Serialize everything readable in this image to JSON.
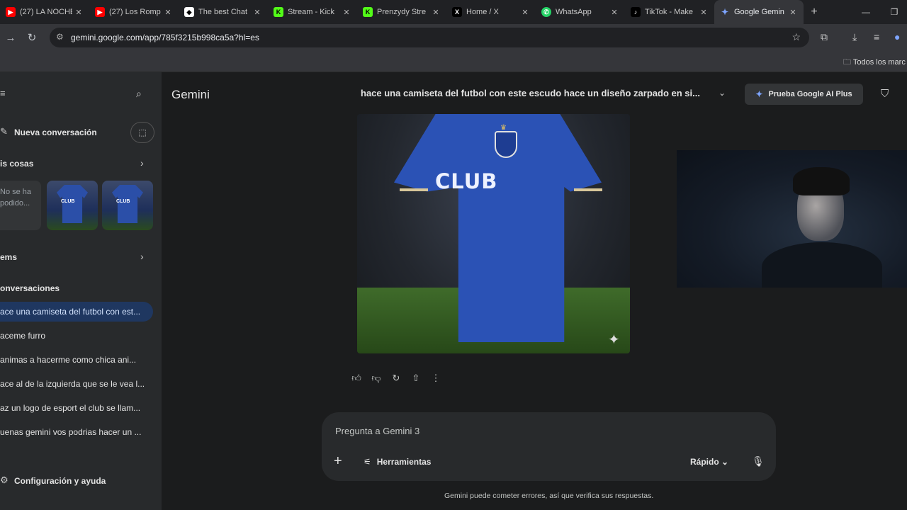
{
  "browser": {
    "tabs": [
      {
        "label": "(27) LA NOCHE",
        "favicon": "youtube-icon",
        "color": "#ff0000"
      },
      {
        "label": "(27) Los Romp",
        "favicon": "youtube-icon",
        "color": "#ff0000"
      },
      {
        "label": "The best Chat",
        "favicon": "chat-icon",
        "color": "#ffffff"
      },
      {
        "label": "Stream - Kick",
        "favicon": "kick-icon",
        "color": "#53fc18"
      },
      {
        "label": "Prenzydy Stre",
        "favicon": "kick-icon",
        "color": "#53fc18"
      },
      {
        "label": "Home / X",
        "favicon": "x-icon",
        "color": "#ffffff"
      },
      {
        "label": "WhatsApp",
        "favicon": "whatsapp-icon",
        "color": "#25d366"
      },
      {
        "label": "TikTok - Make",
        "favicon": "tiktok-icon",
        "color": "#ffffff"
      },
      {
        "label": "Google Gemin",
        "favicon": "gemini-icon",
        "color": "#7ea5ff",
        "active": true
      }
    ],
    "url": "gemini.google.com/app/785f3215b998ca5a?hl=es",
    "bookmarks_label": "Todos los marc"
  },
  "sidebar": {
    "new_chat": "Nueva conversación",
    "my_stuff": "is cosas",
    "not_loaded": "No se ha podido...",
    "gems": "ems",
    "conversations_header": "onversaciones",
    "conversations": [
      {
        "label": "ace una camiseta del futbol con est...",
        "active": true
      },
      {
        "label": "aceme furro"
      },
      {
        "label": "animas a hacerme como chica ani..."
      },
      {
        "label": "ace al de la izquierda que se le vea l..."
      },
      {
        "label": "az un logo de esport el club se llam..."
      },
      {
        "label": "uenas gemini vos podrias hacer un ..."
      }
    ],
    "settings": "Configuración y ayuda"
  },
  "header": {
    "brand": "Gemini",
    "conversation_title": "hace una camiseta del futbol con este escudo hace un diseño zarpado en si...",
    "upgrade_button": "Prueba Google AI Plus"
  },
  "image": {
    "shirt_text": "CLUB",
    "shirt_color": "#2b52b5"
  },
  "composer": {
    "placeholder": "Pregunta a Gemini 3",
    "tools_label": "Herramientas",
    "mode_label": "Rápido"
  },
  "footer": {
    "disclaimer": "Gemini puede cometer errores, así que verifica sus respuestas."
  }
}
